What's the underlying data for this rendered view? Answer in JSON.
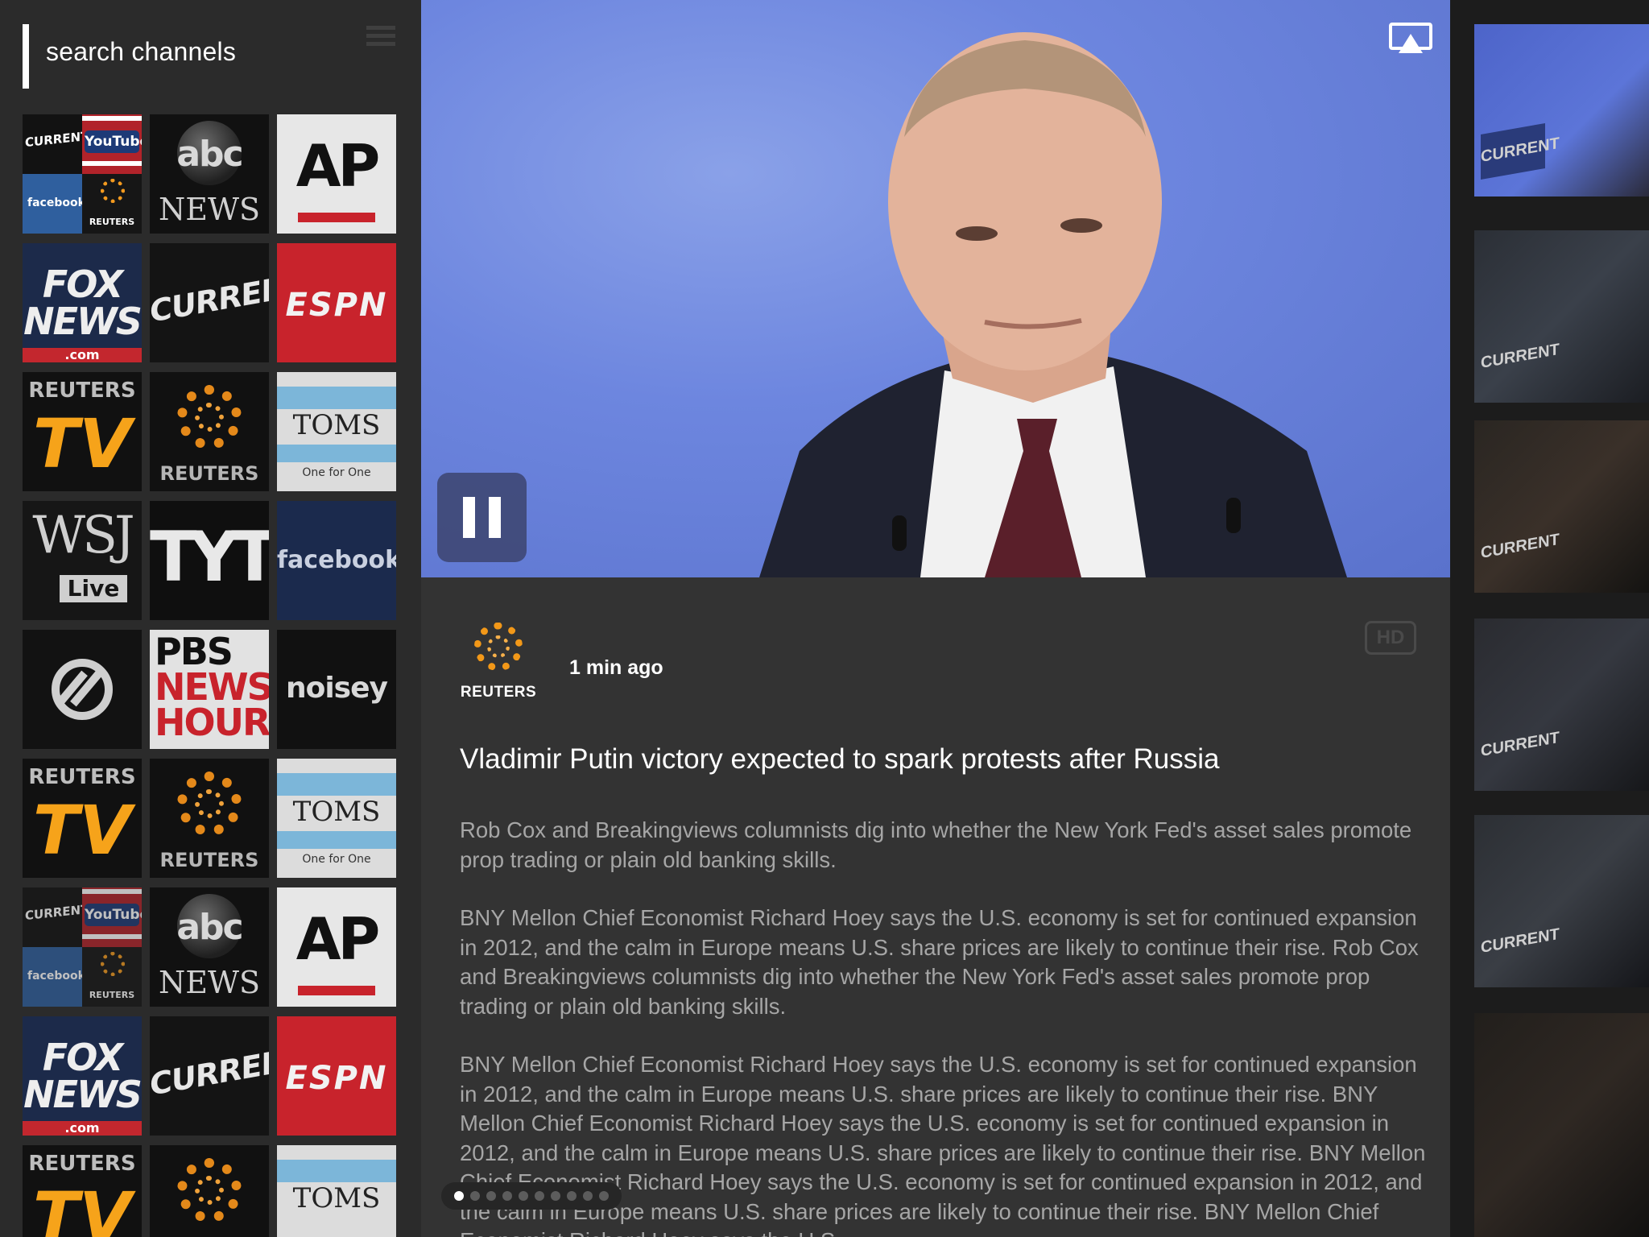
{
  "sidebar": {
    "search_placeholder": "search channels",
    "tiles": [
      {
        "name": "multi-channel",
        "labels": [
          "CURRENT",
          "YouTube",
          "facebook",
          "REUTERS"
        ]
      },
      {
        "name": "abc-news",
        "top": "abc",
        "bottom": "NEWS"
      },
      {
        "name": "ap",
        "text": "AP"
      },
      {
        "name": "fox-news",
        "top": "FOX",
        "middle": "NEWS",
        "bottom": ".com"
      },
      {
        "name": "current",
        "text": "CURRENT"
      },
      {
        "name": "espn",
        "text": "ESPN"
      },
      {
        "name": "reuters-tv",
        "top": "REUTERS",
        "bottom": "TV"
      },
      {
        "name": "reuters",
        "text": "REUTERS"
      },
      {
        "name": "toms",
        "top": "TOMS",
        "bottom": "One for One"
      },
      {
        "name": "wsj-live",
        "top": "WSJ",
        "bottom": "Live"
      },
      {
        "name": "tyt",
        "text": "TYT"
      },
      {
        "name": "facebook",
        "text": "facebook"
      },
      {
        "name": "circle-channel",
        "text": ""
      },
      {
        "name": "pbs-newshour",
        "lines": [
          "PBS",
          "NEWS",
          "HOUR"
        ]
      },
      {
        "name": "noisey",
        "text": "noisey"
      }
    ]
  },
  "video": {
    "state": "playing",
    "pause_icon": "pause-icon",
    "airplay_icon": "airplay-icon",
    "colors": {
      "background": "#6d86df"
    }
  },
  "article": {
    "source": "REUTERS",
    "time_ago": "1 min ago",
    "quality_badge": "HD",
    "headline": "Vladimir Putin victory expected to spark protests after Russia",
    "paragraphs": [
      "Rob Cox and Breakingviews columnists dig into whether the New York Fed's asset sales promote prop trading or plain old banking skills.",
      "BNY Mellon Chief Economist Richard Hoey says the U.S. economy is set for continued expansion in 2012, and the calm in Europe means U.S. share prices are likely to continue their rise. Rob Cox and Breakingviews columnists dig into whether the New York Fed's asset sales promote prop trading or plain old banking skills.",
      "BNY Mellon Chief Economist Richard Hoey says the U.S. economy is set for continued expansion in 2012, and the calm in Europe means U.S. share prices are likely to continue their rise. BNY Mellon Chief Economist Richard Hoey says the U.S. economy is set for continued expansion in 2012, and the calm in Europe means U.S. share prices are likely to continue their rise. BNY Mellon Chief Economist Richard Hoey says the U.S. economy is set for continued expansion in 2012, and the calm in Europe means U.S. share prices are likely to continue their rise. BNY Mellon Chief Economist Richard Hoey says the U.S."
    ],
    "pager": {
      "total": 10,
      "current": 1
    }
  },
  "right_strip": {
    "badge_text": "CURRENT",
    "thumbnails": 7
  },
  "colors": {
    "sidebar_bg": "#2b2b2b",
    "article_bg": "#333333",
    "reuters_orange": "#f29818",
    "espn_red": "#c8232c"
  }
}
